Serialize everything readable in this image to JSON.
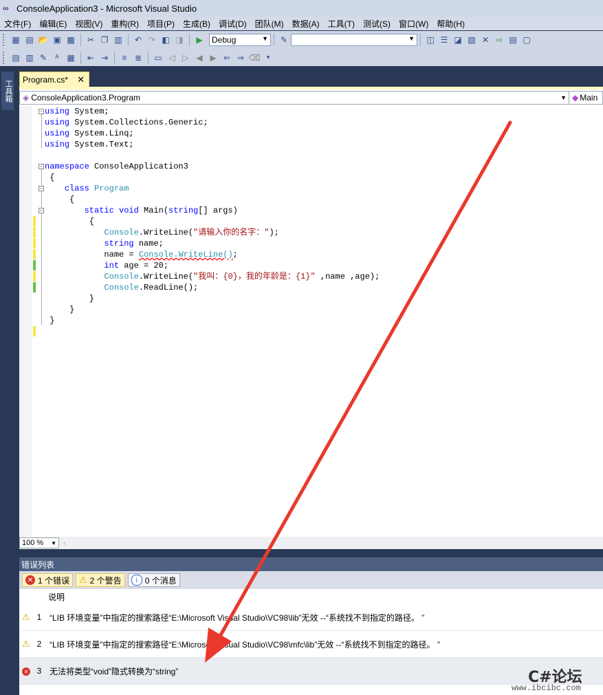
{
  "window": {
    "title": "ConsoleApplication3 - Microsoft Visual Studio"
  },
  "menu": [
    "文件(F)",
    "编辑(E)",
    "视图(V)",
    "重构(R)",
    "项目(P)",
    "生成(B)",
    "调试(D)",
    "团队(M)",
    "数据(A)",
    "工具(T)",
    "测试(S)",
    "窗口(W)",
    "帮助(H)"
  ],
  "toolbar": {
    "config": "Debug",
    "search_value": ""
  },
  "sidebar": {
    "toolbox_label": "工具箱"
  },
  "tab": {
    "label": "Program.cs*",
    "close": "✕"
  },
  "nav": {
    "class_selector": "ConsoleApplication3.Program",
    "member_selector": "Main"
  },
  "code_lines": [
    "using System;",
    "using System.Collections.Generic;",
    "using System.Linq;",
    "using System.Text;",
    "",
    "namespace ConsoleApplication3",
    "{",
    "    class Program",
    "    {",
    "        static void Main(string[] args)",
    "        {",
    "            Console.WriteLine(\"请输入你的名字：\");",
    "            string name;",
    "            name = Console.WriteLine();",
    "            int age = 20;",
    "            Console.WriteLine(\"我叫：{0}，我的年龄是：{1}\" ,name ,age);",
    "            Console.ReadLine();",
    "        }",
    "    }",
    "}"
  ],
  "zoom": "100 %",
  "error_list": {
    "title": "错误列表",
    "filters": {
      "errors": "1 个错误",
      "warnings": "2 个警告",
      "messages": "0 个消息"
    },
    "column_header": "说明",
    "rows": [
      {
        "num": "1",
        "type": "warning",
        "description": "“LIB 环境变量”中指定的搜索路径“E:\\Microsoft Visual Studio\\VC98\\lib”无效 --“系统找不到指定的路径。 ”"
      },
      {
        "num": "2",
        "type": "warning",
        "description": "“LIB 环境变量”中指定的搜索路径“E:\\Microsoft Visual Studio\\VC98\\mfc\\lib”无效 --“系统找不到指定的路径。 ”"
      },
      {
        "num": "3",
        "type": "error",
        "description": "无法将类型“void”隐式转换为“string”"
      }
    ]
  },
  "watermark": {
    "brand": "C#论坛",
    "url": "www.ibcibc.com"
  },
  "colors": {
    "annotation_arrow": "#e8392c",
    "error": "#d9342b",
    "warning": "#f0c419",
    "info": "#2f6fd1"
  }
}
